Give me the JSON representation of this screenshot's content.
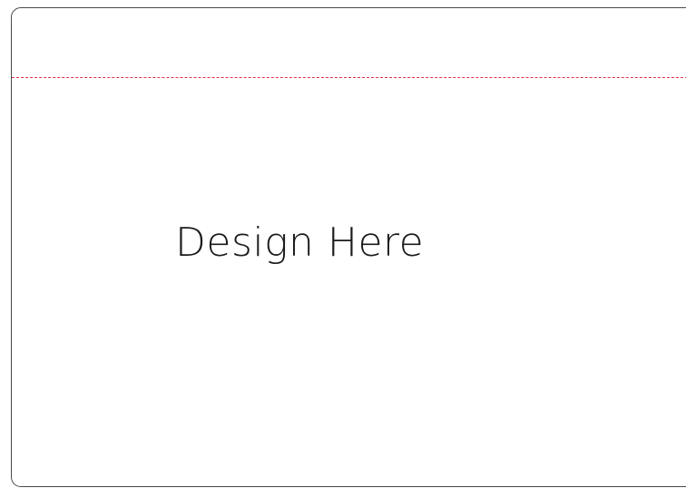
{
  "canvas": {
    "placeholder_text": "Design Here",
    "border_color": "#4a4a4a",
    "guide_line_color": "#e0304a"
  }
}
